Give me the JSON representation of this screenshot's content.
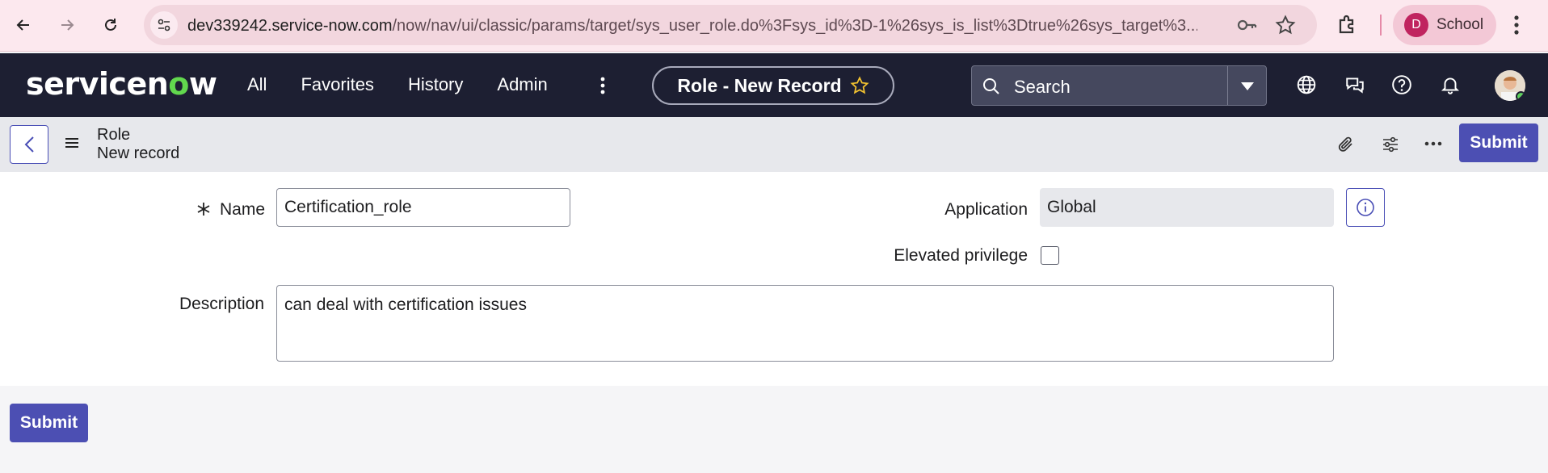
{
  "browser": {
    "url_host": "dev339242.service-now.com",
    "url_path": "/now/nav/ui/classic/params/target/sys_user_role.do%3Fsys_id%3D-1%26sys_is_list%3Dtrue%26sys_target%3...",
    "profile_initial": "D",
    "profile_label": "School"
  },
  "header": {
    "logo_pre": "servicen",
    "logo_o": "o",
    "logo_post": "w",
    "nav": [
      "All",
      "Favorites",
      "History",
      "Admin"
    ],
    "record_title": "Role - New Record",
    "search_placeholder": "Search"
  },
  "subheader": {
    "title": "Role",
    "subtitle": "New record",
    "submit_label": "Submit"
  },
  "form": {
    "name_label": "Name",
    "name_value": "Certification_role",
    "application_label": "Application",
    "application_value": "Global",
    "elevated_label": "Elevated privilege",
    "elevated_checked": false,
    "description_label": "Description",
    "description_value": "can deal with certification issues"
  },
  "footer": {
    "submit_label": "Submit"
  },
  "colors": {
    "header_bg": "#1d1f32",
    "accent": "#4c4fb3",
    "logo_accent": "#62d84e"
  }
}
